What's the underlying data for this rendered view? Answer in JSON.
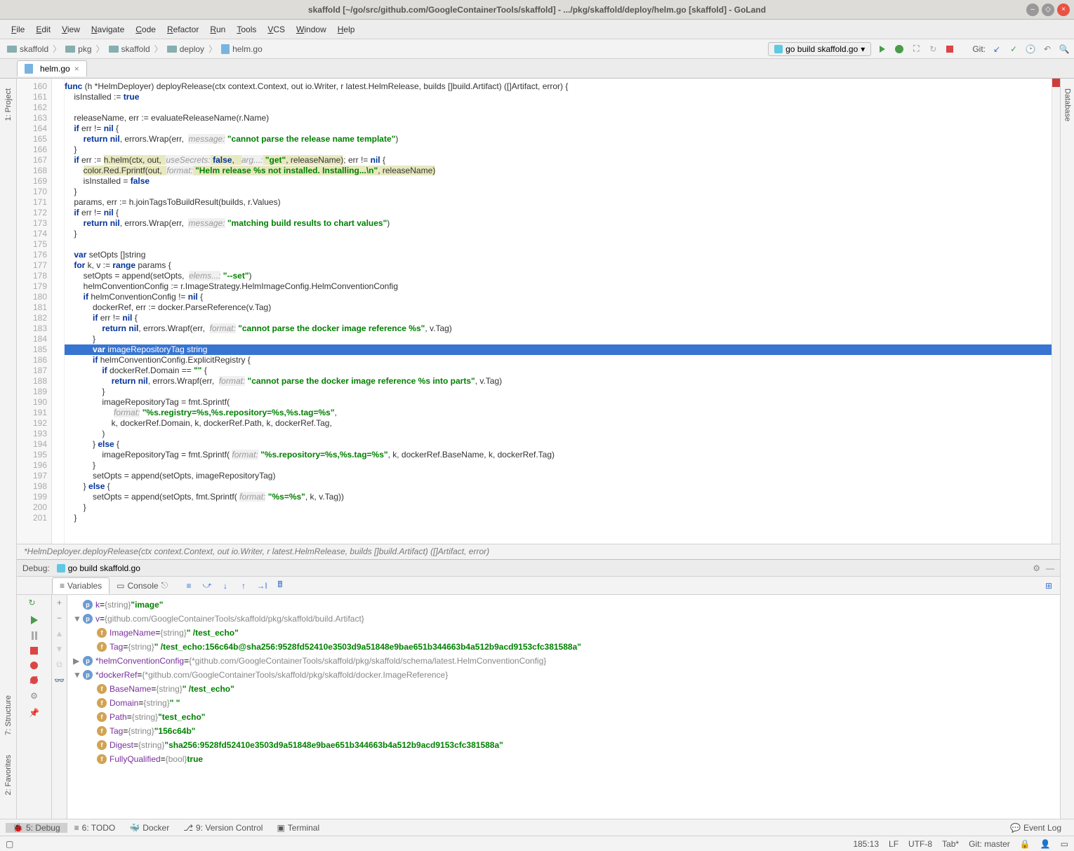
{
  "window": {
    "title": "skaffold [~/go/src/github.com/GoogleContainerTools/skaffold] - .../pkg/skaffold/deploy/helm.go [skaffold] - GoLand"
  },
  "menu": [
    "File",
    "Edit",
    "View",
    "Navigate",
    "Code",
    "Refactor",
    "Run",
    "Tools",
    "VCS",
    "Window",
    "Help"
  ],
  "breadcrumbs": [
    {
      "icon": "folder",
      "label": "skaffold"
    },
    {
      "icon": "folder",
      "label": "pkg"
    },
    {
      "icon": "folder",
      "label": "skaffold"
    },
    {
      "icon": "folder",
      "label": "deploy"
    },
    {
      "icon": "file",
      "label": "helm.go"
    }
  ],
  "run_config": "go build skaffold.go",
  "git_label": "Git:",
  "tabs": [
    {
      "label": "helm.go"
    }
  ],
  "lines_start": 160,
  "lines_end": 201,
  "code_lines": [
    {
      "n": 160,
      "t": "func",
      "html": "<span class='kw'>func</span> (h *HelmDeployer) deployRelease(ctx context.Context, out io.Writer, r latest.HelmRelease, builds []build.Artifact) ([]Artifact, error) {"
    },
    {
      "n": 161,
      "t": "",
      "html": "    isInstalled := <span class='kw'>true</span>"
    },
    {
      "n": 162,
      "t": "",
      "html": ""
    },
    {
      "n": 163,
      "t": "",
      "html": "    releaseName, err := evaluateReleaseName(r.Name)"
    },
    {
      "n": 164,
      "t": "",
      "html": "    <span class='kw'>if</span> err != <span class='kw'>nil</span> {"
    },
    {
      "n": 165,
      "t": "",
      "html": "        <span class='kw'>return</span> <span class='kw'>nil</span>, errors.Wrap(err,  <span class='hint'>message:</span> <span class='str'>\"cannot parse the release name template\"</span>)"
    },
    {
      "n": 166,
      "t": "",
      "html": "    }"
    },
    {
      "n": 167,
      "t": "",
      "html": "    <span class='kw'>if</span> err := <span class='hl'>h.helm(ctx, out,  <span class='hint'>useSecrets:</span> <span class='kw'>false</span>,   <span class='hint'>arg...:</span> <span class='str'>\"get\"</span>, releaseName)</span>; err != <span class='kw'>nil</span> {"
    },
    {
      "n": 168,
      "t": "",
      "html": "        <span class='hl'>color.Red.Fprintf(out,  <span class='hint'>format:</span> <span class='str'>\"Helm release %s not installed. Installing...\\n\"</span>, releaseName)</span>"
    },
    {
      "n": 169,
      "t": "",
      "html": "        isInstalled = <span class='kw'>false</span>"
    },
    {
      "n": 170,
      "t": "",
      "html": "    }"
    },
    {
      "n": 171,
      "t": "",
      "html": "    params, err := h.joinTagsToBuildResult(builds, r.Values)"
    },
    {
      "n": 172,
      "t": "",
      "html": "    <span class='kw'>if</span> err != <span class='kw'>nil</span> {"
    },
    {
      "n": 173,
      "t": "",
      "html": "        <span class='kw'>return</span> <span class='kw'>nil</span>, errors.Wrap(err,  <span class='hint'>message:</span> <span class='str'>\"matching build results to chart values\"</span>)"
    },
    {
      "n": 174,
      "t": "",
      "html": "    }"
    },
    {
      "n": 175,
      "t": "",
      "html": ""
    },
    {
      "n": 176,
      "t": "",
      "html": "    <span class='kw'>var</span> setOpts []string"
    },
    {
      "n": 177,
      "t": "",
      "html": "    <span class='kw'>for</span> k, v := <span class='kw'>range</span> params {"
    },
    {
      "n": 178,
      "t": "",
      "html": "        setOpts = append(setOpts,  <span class='hint'>elems...:</span> <span class='str'>\"--set\"</span>)"
    },
    {
      "n": 179,
      "t": "",
      "html": "        helmConventionConfig := r.ImageStrategy.HelmImageConfig.HelmConventionConfig"
    },
    {
      "n": 180,
      "t": "",
      "html": "        <span class='kw'>if</span> helmConventionConfig != <span class='kw'>nil</span> {"
    },
    {
      "n": 181,
      "t": "",
      "html": "            dockerRef, err := docker.ParseReference(v.Tag)"
    },
    {
      "n": 182,
      "t": "",
      "html": "            <span class='kw'>if</span> err != <span class='kw'>nil</span> {"
    },
    {
      "n": 183,
      "t": "",
      "html": "                <span class='kw'>return</span> <span class='kw'>nil</span>, errors.Wrapf(err,  <span class='hint'>format:</span> <span class='str'>\"cannot parse the docker image reference %s\"</span>, v.Tag)"
    },
    {
      "n": 184,
      "t": "",
      "html": "            }"
    },
    {
      "n": 185,
      "t": "sel",
      "html": "            <span class='kw'>var</span> imageRepositoryTag string"
    },
    {
      "n": 186,
      "t": "",
      "html": "            <span class='kw'>if</span> helmConventionConfig.ExplicitRegistry {"
    },
    {
      "n": 187,
      "t": "",
      "html": "                <span class='kw'>if</span> dockerRef.Domain == <span class='str'>\"\"</span> {"
    },
    {
      "n": 188,
      "t": "",
      "html": "                    <span class='kw'>return</span> <span class='kw'>nil</span>, errors.Wrapf(err,  <span class='hint'>format:</span> <span class='str'>\"cannot parse the docker image reference %s into parts\"</span>, v.Tag)"
    },
    {
      "n": 189,
      "t": "",
      "html": "                }"
    },
    {
      "n": 190,
      "t": "",
      "html": "                imageRepositoryTag = fmt.Sprintf("
    },
    {
      "n": 191,
      "t": "",
      "html": "                     <span class='hint'>format:</span> <span class='str'>\"%s.registry=%s,%s.repository=%s,%s.tag=%s\"</span>,"
    },
    {
      "n": 192,
      "t": "",
      "html": "                    k, dockerRef.Domain, k, dockerRef.Path, k, dockerRef.Tag,"
    },
    {
      "n": 193,
      "t": "",
      "html": "                )"
    },
    {
      "n": 194,
      "t": "",
      "html": "            } <span class='kw'>else</span> {"
    },
    {
      "n": 195,
      "t": "",
      "html": "                imageRepositoryTag = fmt.Sprintf( <span class='hint'>format:</span> <span class='str'>\"%s.repository=%s,%s.tag=%s\"</span>, k, dockerRef.BaseName, k, dockerRef.Tag)"
    },
    {
      "n": 196,
      "t": "",
      "html": "            }"
    },
    {
      "n": 197,
      "t": "",
      "html": "            setOpts = append(setOpts, imageRepositoryTag)"
    },
    {
      "n": 198,
      "t": "",
      "html": "        } <span class='kw'>else</span> {"
    },
    {
      "n": 199,
      "t": "",
      "html": "            setOpts = append(setOpts, fmt.Sprintf( <span class='hint'>format:</span> <span class='str'>\"%s=%s\"</span>, k, v.Tag))"
    },
    {
      "n": 200,
      "t": "",
      "html": "        }"
    },
    {
      "n": 201,
      "t": "",
      "html": "    }"
    }
  ],
  "breadcrumb_bottom": "*HelmDeployer.deployRelease(ctx context.Context, out io.Writer, r latest.HelmRelease, builds []build.Artifact) ([]Artifact, error)",
  "debug": {
    "title": "Debug:",
    "config": "go build skaffold.go",
    "tabs": {
      "variables": "Variables",
      "console": "Console"
    },
    "vars": [
      {
        "indent": 0,
        "exp": "",
        "badge": "p",
        "name": "k",
        "eq": " = ",
        "type": "{string} ",
        "val": "\"image\""
      },
      {
        "indent": 0,
        "exp": "▼",
        "badge": "p",
        "name": "v",
        "eq": " = ",
        "type": "{github.com/GoogleContainerTools/skaffold/pkg/skaffold/build.Artifact}",
        "val": ""
      },
      {
        "indent": 1,
        "exp": "",
        "badge": "f",
        "name": "ImageName",
        "eq": " = ",
        "type": "{string} ",
        "val": "\"            /test_echo\""
      },
      {
        "indent": 1,
        "exp": "",
        "badge": "f",
        "name": "Tag",
        "eq": " = ",
        "type": "{string} ",
        "val": "\"            /test_echo:156c64b@sha256:9528fd52410e3503d9a51848e9bae651b344663b4a512b9acd9153cfc381588a\""
      },
      {
        "indent": 0,
        "exp": "▶",
        "badge": "p",
        "name": "*helmConventionConfig",
        "eq": " = ",
        "type": "{*github.com/GoogleContainerTools/skaffold/pkg/skaffold/schema/latest.HelmConventionConfig}",
        "val": ""
      },
      {
        "indent": 0,
        "exp": "▼",
        "badge": "p",
        "name": "*dockerRef",
        "eq": " = ",
        "type": "{*github.com/GoogleContainerTools/skaffold/pkg/skaffold/docker.ImageReference}",
        "val": ""
      },
      {
        "indent": 1,
        "exp": "",
        "badge": "f",
        "name": "BaseName",
        "eq": " = ",
        "type": "{string} ",
        "val": "\"            /test_echo\""
      },
      {
        "indent": 1,
        "exp": "",
        "badge": "f",
        "name": "Domain",
        "eq": " = ",
        "type": "{string} ",
        "val": "\"            \""
      },
      {
        "indent": 1,
        "exp": "",
        "badge": "f",
        "name": "Path",
        "eq": " = ",
        "type": "{string} ",
        "val": "\"test_echo\""
      },
      {
        "indent": 1,
        "exp": "",
        "badge": "f",
        "name": "Tag",
        "eq": " = ",
        "type": "{string} ",
        "val": "\"156c64b\""
      },
      {
        "indent": 1,
        "exp": "",
        "badge": "f",
        "name": "Digest",
        "eq": " = ",
        "type": "{string} ",
        "val": "\"sha256:9528fd52410e3503d9a51848e9bae651b344663b4a512b9acd9153cfc381588a\""
      },
      {
        "indent": 1,
        "exp": "",
        "badge": "f",
        "name": "FullyQualified",
        "eq": " = ",
        "type": "{bool} ",
        "val": "true"
      }
    ]
  },
  "bottom_tools": {
    "debug": "5: Debug",
    "todo": "6: TODO",
    "docker": "Docker",
    "vcs": "9: Version Control",
    "terminal": "Terminal",
    "eventlog": "Event Log"
  },
  "status": {
    "pos": "185:13",
    "sep": "LF",
    "enc": "UTF-8",
    "indent": "Tab*",
    "git": "Git: master"
  },
  "side_tabs": {
    "project": "1: Project",
    "structure": "7: Structure",
    "favorites": "2: Favorites",
    "database": "Database"
  }
}
